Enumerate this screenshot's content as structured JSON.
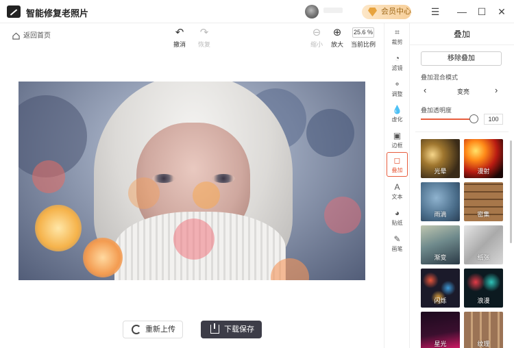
{
  "app": {
    "title": "智能修复老照片",
    "vip_label": "会员中心"
  },
  "window": {
    "menu": "☰",
    "minimize": "—",
    "maximize": "☐",
    "close": "✕"
  },
  "toolbar": {
    "back_label": "返回首页",
    "undo_label": "撤消",
    "redo_label": "恢复",
    "zoom_out_label": "缩小",
    "zoom_in_label": "放大",
    "zoom_value": "25.6 %",
    "current_ratio_label": "当前比例"
  },
  "buttons": {
    "reupload": "重新上传",
    "download": "下载保存"
  },
  "rail": {
    "items": [
      {
        "label": "裁剪",
        "icon": "crop-icon"
      },
      {
        "label": "滤镜",
        "icon": "filter-icon"
      },
      {
        "label": "调整",
        "icon": "adjust-icon"
      },
      {
        "label": "虚化",
        "icon": "blur-icon"
      },
      {
        "label": "边框",
        "icon": "frame-icon"
      },
      {
        "label": "叠加",
        "icon": "overlay-icon",
        "active": true
      },
      {
        "label": "文本",
        "icon": "text-icon"
      },
      {
        "label": "贴纸",
        "icon": "sticker-icon"
      },
      {
        "label": "画笔",
        "icon": "brush-icon"
      }
    ]
  },
  "panel": {
    "title": "叠加",
    "remove_label": "移除叠加",
    "blend_mode_label": "叠加混合模式",
    "blend_mode_value": "变亮",
    "opacity_label": "叠加透明度",
    "opacity_value": "100",
    "overlays": [
      {
        "label": "光晕"
      },
      {
        "label": "漫射"
      },
      {
        "label": "雨滴"
      },
      {
        "label": "密集"
      },
      {
        "label": "渐变"
      },
      {
        "label": "纸张"
      },
      {
        "label": "闪烁"
      },
      {
        "label": "浪漫"
      },
      {
        "label": "星光"
      },
      {
        "label": "纹理"
      }
    ]
  },
  "colors": {
    "accent": "#e75b3b",
    "download_bg": "#3d3d48",
    "vip_text": "#a06a1b"
  }
}
